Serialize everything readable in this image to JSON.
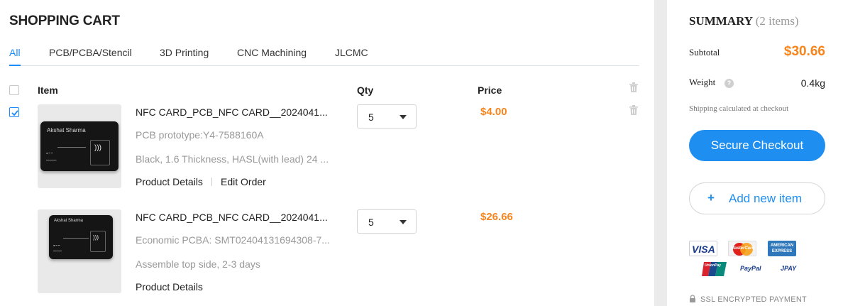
{
  "page": {
    "title": "SHOPPING CART"
  },
  "tabs": [
    {
      "label": "All",
      "active": true
    },
    {
      "label": "PCB/PCBA/Stencil"
    },
    {
      "label": "3D Printing"
    },
    {
      "label": "CNC Machining"
    },
    {
      "label": "JLCMC"
    }
  ],
  "table": {
    "col_item": "Item",
    "col_qty": "Qty",
    "col_price": "Price"
  },
  "items": [
    {
      "checked": true,
      "name": "NFC CARD_PCB_NFC CARD__2024041...",
      "line1": "PCB prototype:Y4-7588160A",
      "line2": "Black, 1.6 Thickness, HASL(with lead) 24 ...",
      "link1": "Product Details",
      "link2": "Edit Order",
      "qty": "5",
      "price": "$4.00",
      "card_name": "Akshat Sharma"
    },
    {
      "checked": false,
      "name": "NFC CARD_PCB_NFC CARD__2024041...",
      "line1": "Economic PCBA: SMT02404131694308-7...",
      "line2": "Assemble top side, 2-3 days",
      "link1": "Product Details",
      "qty": "5",
      "price": "$26.66",
      "card_name": "Akshat Sharma"
    }
  ],
  "summary": {
    "title": "SUMMARY",
    "count": "(2 items)",
    "subtotal_label": "Subtotal",
    "subtotal": "$30.66",
    "weight_label": "Weight",
    "weight": "0.4kg",
    "shipping_note": "Shipping calculated at checkout",
    "checkout_label": "Secure Checkout",
    "add_label": "Add new item",
    "add_symbol": "+",
    "ssl_label": "SSL ENCRYPTED PAYMENT"
  },
  "payment_logos": {
    "visa": "VISA",
    "mastercard": "MasterCard",
    "amex": "AMERICAN EXPRESS",
    "unionpay": "UnionPay",
    "paypal": "PayPal",
    "jcb": "JPAY"
  },
  "colors": {
    "accent": "#1a8cff",
    "price": "#f7841c",
    "checkout_bg": "#1f8ef1"
  }
}
